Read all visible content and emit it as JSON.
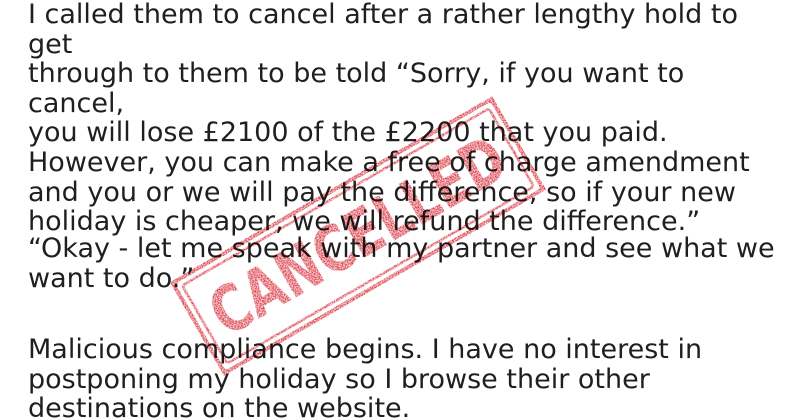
{
  "post": {
    "paragraph_1": "I called them to cancel after a rather lengthy hold to get\nthrough to them to be told “Sorry, if you want to cancel,\nyou will lose £2100 of the £2200 that you paid.\nHowever, you can make a free of charge amendment\nand you or we will pay the difference, so if your new\nholiday is cheaper, we will refund the difference.”",
    "paragraph_2": "“Okay - let me speak with my partner and see what we\nwant to do.”",
    "paragraph_3": "Malicious compliance begins. I have no interest in\npostponing my holiday so I browse their other\ndestinations on the website."
  },
  "stamp": {
    "text": "CANCELLED",
    "color": "#d51f2b"
  }
}
